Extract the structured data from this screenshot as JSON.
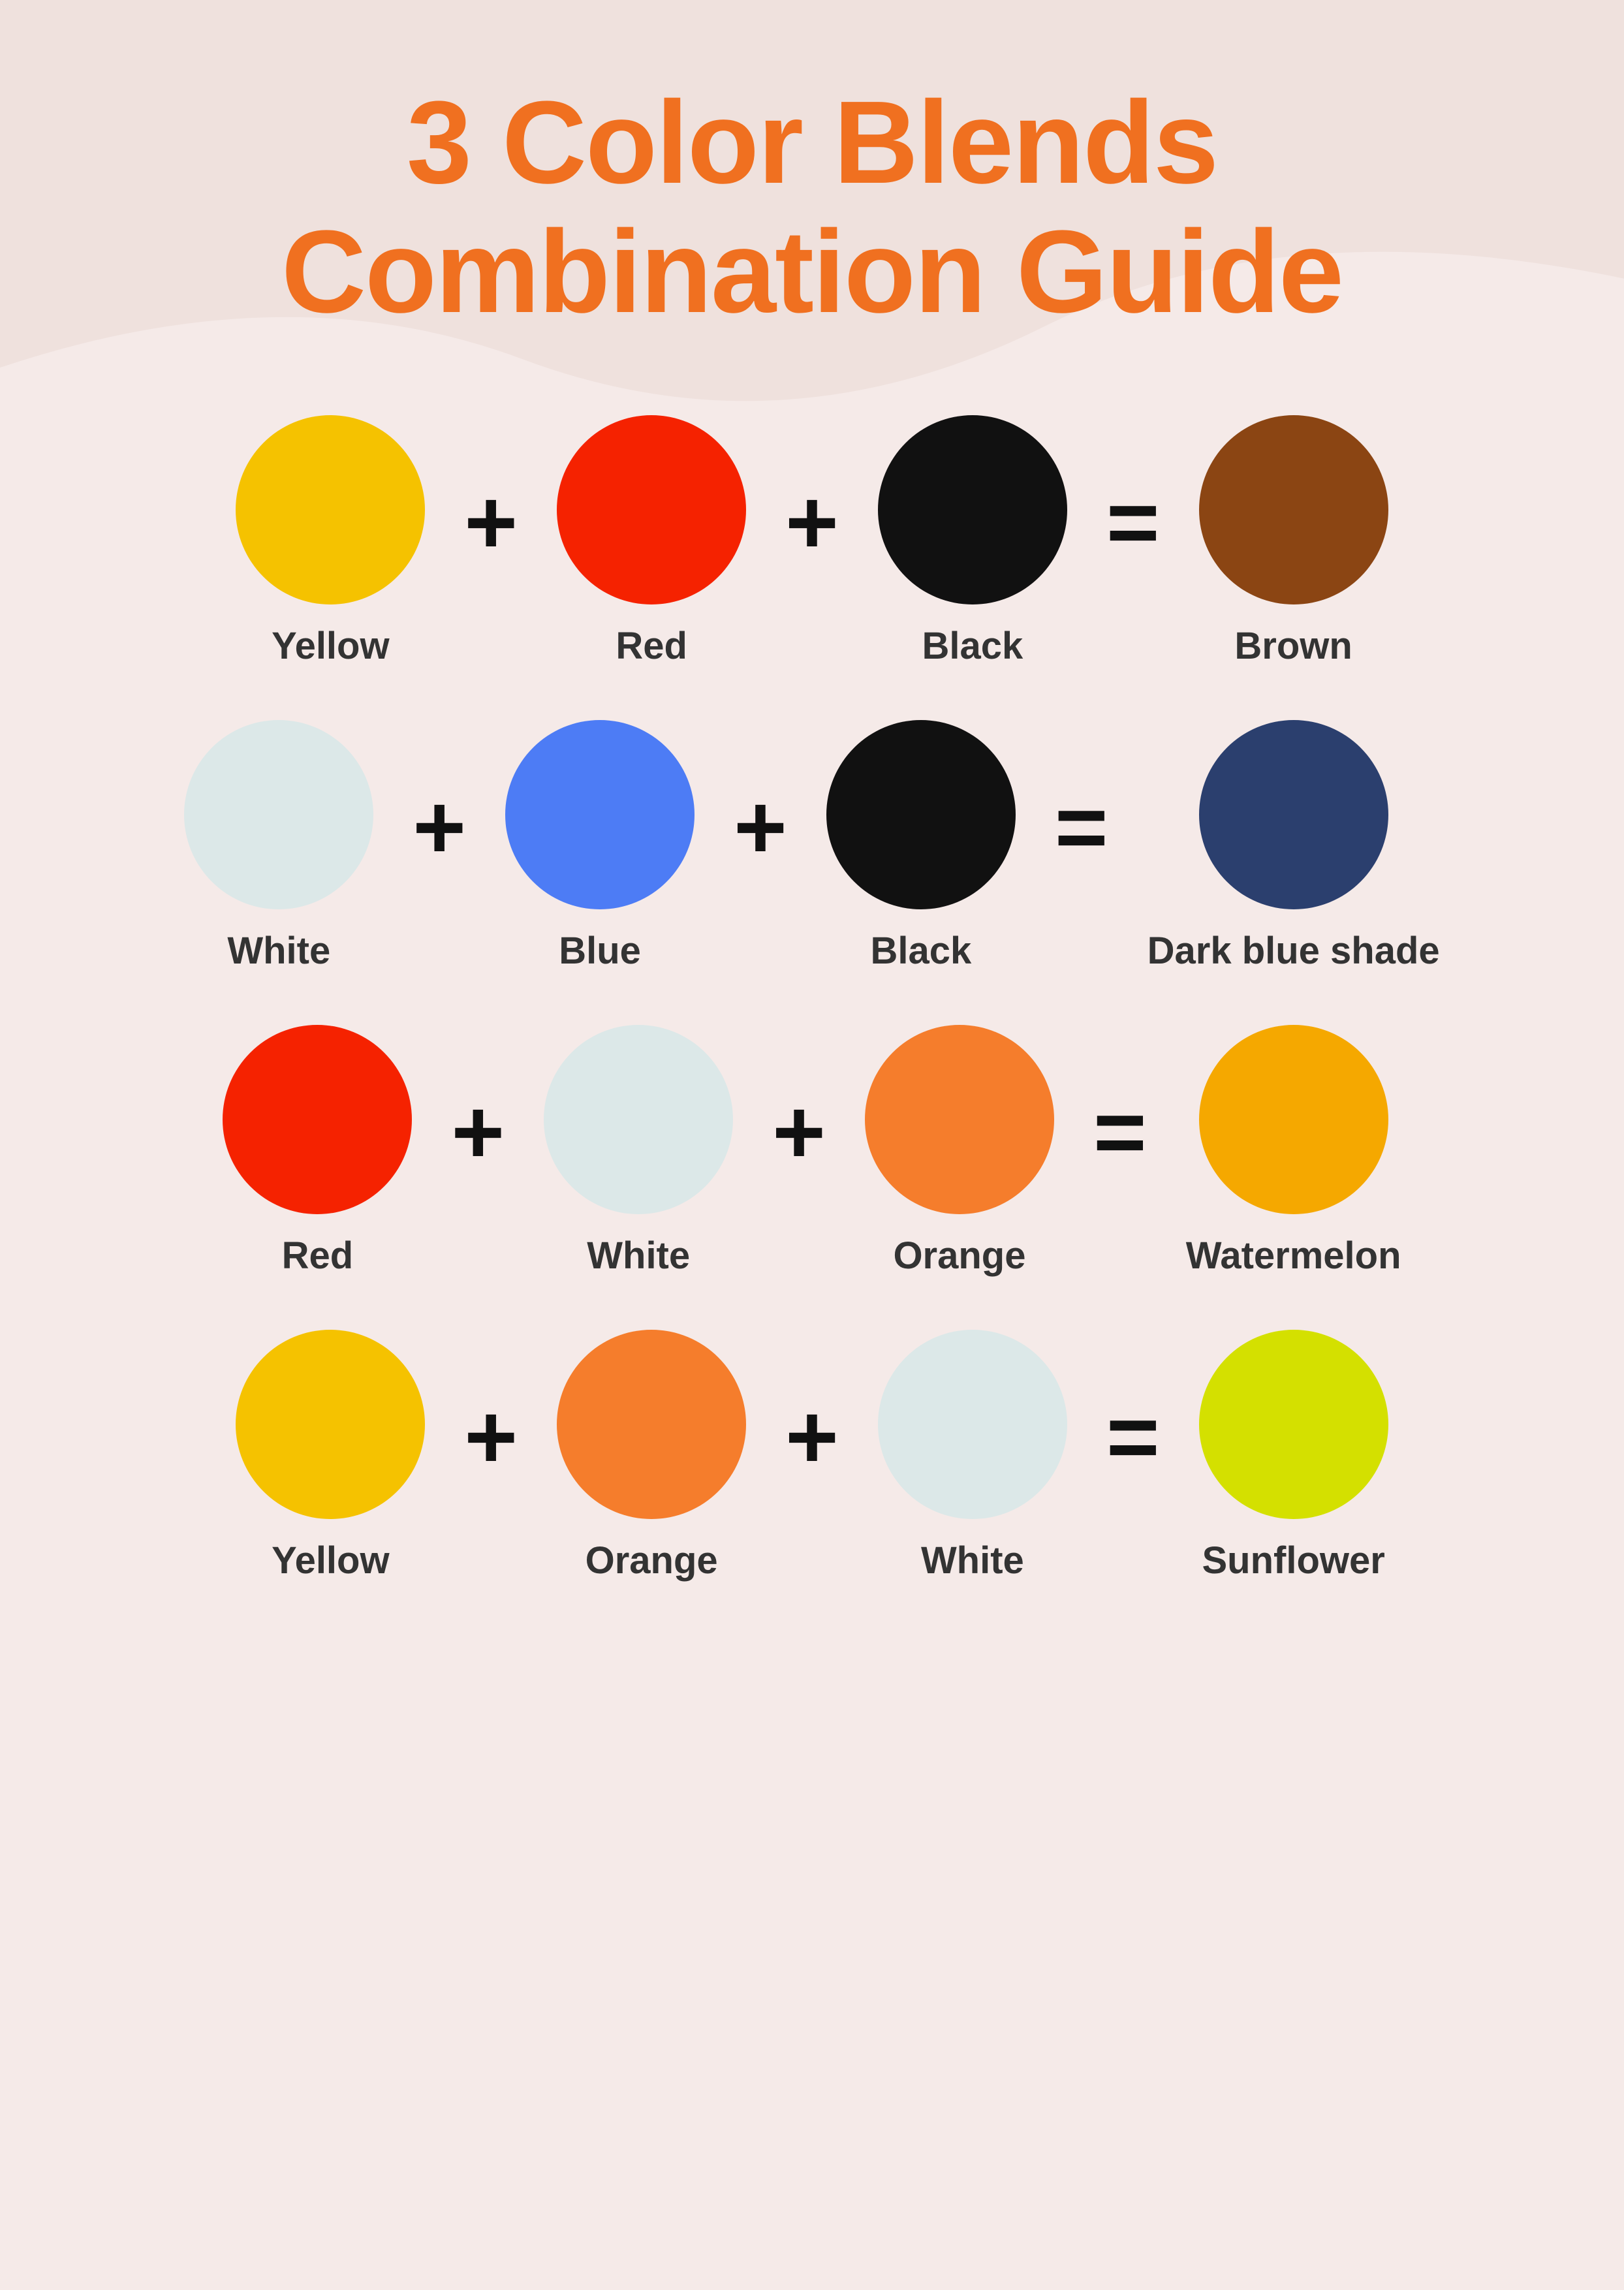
{
  "title": {
    "line1": "3 Color Blends",
    "line2": "Combination Guide"
  },
  "accent_color": "#f07020",
  "background_color": "#f5eae8",
  "rows": [
    {
      "id": "row1",
      "colors": [
        {
          "name": "Yellow",
          "hex": "#F5C200",
          "label": "Yellow"
        },
        {
          "name": "Red",
          "hex": "#F52200",
          "label": "Red"
        },
        {
          "name": "Black",
          "hex": "#111111",
          "label": "Black"
        }
      ],
      "result": {
        "name": "Brown",
        "hex": "#8B4513",
        "label": "Brown"
      }
    },
    {
      "id": "row2",
      "colors": [
        {
          "name": "White",
          "hex": "#dce8e8",
          "label": "White"
        },
        {
          "name": "Blue",
          "hex": "#4d7cf5",
          "label": "Blue"
        },
        {
          "name": "Black",
          "hex": "#111111",
          "label": "Black"
        }
      ],
      "result": {
        "name": "Dark blue shade",
        "hex": "#2b3f6e",
        "label": "Dark blue shade"
      }
    },
    {
      "id": "row3",
      "colors": [
        {
          "name": "Red",
          "hex": "#F52200",
          "label": "Red"
        },
        {
          "name": "White",
          "hex": "#dce8e8",
          "label": "White"
        },
        {
          "name": "Orange",
          "hex": "#F57D2C",
          "label": "Orange"
        }
      ],
      "result": {
        "name": "Watermelon",
        "hex": "#F5A800",
        "label": "Watermelon"
      }
    },
    {
      "id": "row4",
      "colors": [
        {
          "name": "Yellow",
          "hex": "#F5C200",
          "label": "Yellow"
        },
        {
          "name": "Orange",
          "hex": "#F57D2C",
          "label": "Orange"
        },
        {
          "name": "White",
          "hex": "#dce8e8",
          "label": "White"
        }
      ],
      "result": {
        "name": "Sunflower",
        "hex": "#d4e000",
        "label": "Sunflower"
      }
    }
  ],
  "operators": {
    "plus": "+",
    "equals": "="
  }
}
